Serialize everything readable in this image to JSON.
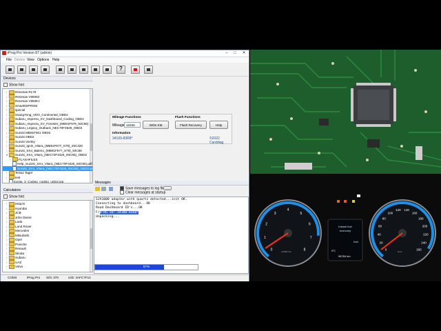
{
  "window": {
    "title": "iProg Pro Version 87 (admin)",
    "min": "–",
    "max": "□",
    "close": "✕"
  },
  "menu": [
    "File",
    "Device",
    "View",
    "Options",
    "Help"
  ],
  "devices_panel": {
    "title": "Devices",
    "show_hint": "Show hint",
    "items": [
      {
        "label": "Renesas RL78",
        "type": "folder",
        "indent": 1
      },
      {
        "label": "Renesas V85062",
        "type": "folder",
        "indent": 1
      },
      {
        "label": "Renesas V850E1",
        "type": "folder",
        "indent": 1
      },
      {
        "label": "SmartEEPROM",
        "type": "folder",
        "indent": 1
      },
      {
        "label": "special",
        "type": "folder",
        "indent": 1
      },
      {
        "label": "SsangYong_VDO_Continental_OBD2",
        "type": "folder",
        "indent": 1
      },
      {
        "label": "Subaru_Impreza_XV_Dashboard_Coding_OBD2",
        "type": "folder",
        "indent": 1
      },
      {
        "label": "Subaru_Impreza_XV_Forester_(MB91F579_93C86)",
        "type": "folder",
        "indent": 1
      },
      {
        "label": "Subaru_Legacy_Outback_NEC70F3529_OBD2",
        "type": "folder",
        "indent": 1
      },
      {
        "label": "Suzuki MB91F061 OBD2",
        "type": "folder",
        "indent": 1
      },
      {
        "label": "Suzuki OBD2",
        "type": "folder",
        "indent": 1
      },
      {
        "label": "Suzuki Vorsky",
        "type": "folder",
        "indent": 1
      },
      {
        "label": "Suzuki_Ignis_Vitara_(MB91F577_S79)_25C320",
        "type": "folder",
        "indent": 1
      },
      {
        "label": "Suzuki_SX4_Baleno_(MB91F577_S79)_93C86",
        "type": "folder",
        "indent": 1
      },
      {
        "label": "Suzuki_SX4_Vitara_(NEC70F3425_93C86)_OBD2",
        "type": "folder",
        "indent": 1,
        "expanded": true
      },
      {
        "label": "FLASHFILES",
        "type": "folder",
        "indent": 2
      },
      {
        "label": "Help_Suzuki_SX4_Vitara_(NEC70F3425_93C86).pdf",
        "type": "file",
        "indent": 2
      },
      {
        "label": "Suzuki_SX4_Vitara_(NEC70F3425_93C86)_OBD2.ipp",
        "type": "file",
        "indent": 2,
        "selected": true
      },
      {
        "label": "TeSaz Tager",
        "type": "folder",
        "indent": 1
      },
      {
        "label": "test",
        "type": "folder",
        "indent": 1
      },
      {
        "label": "toyota_3_Coding_coding_LED2.ipp",
        "type": "file",
        "indent": 1
      }
    ]
  },
  "center": {
    "mileage_title": "Mileage Functions",
    "mileage_label": "Mileage:",
    "mileage_value": "12345",
    "write_km": "Write KM",
    "flash_title": "Flash Functions",
    "flash_recovery": "Flash Recovery",
    "help": "Help",
    "info_title": "Information",
    "info_value": "34100-83R8*",
    "copyright": "©2022 Carddiag"
  },
  "calc_panel": {
    "title": "Calculators",
    "show_hint": "Show hint",
    "items": [
      "Hitachi",
      "Hyundai",
      "JCB",
      "John Deere",
      "Lada",
      "Land Rover",
      "Mercedes",
      "Mitsubishi",
      "Opel",
      "Porsche",
      "Renault",
      "Skoda",
      "Subaru",
      "UAZ",
      "Volvo"
    ]
  },
  "messages": {
    "title": "Messages",
    "save_log": "Save messages to log file",
    "clear_startup": "Clear messages at startup",
    "browse": "...",
    "lines": [
      "SJA1000 adapter with quartz detected...init OK.",
      "Connecting to dashboard...OK",
      "Read Dashboard ID's...OK",
      "Unpacking..."
    ],
    "line_hl_prefix": "F/",
    "line_hl": "W-RG ID: 34100-83R8*",
    "progress_text": "67%",
    "progress": 0.67
  },
  "status": {
    "port": "COM3",
    "product": "iProg Pro",
    "sn": "S/N: 370",
    "uid": "UID: 4AFC7F14"
  },
  "cluster": {
    "left_marks": [
      "0",
      "1",
      "2",
      "3",
      "4",
      "5",
      "6",
      "7",
      "8"
    ],
    "right_marks": [
      "0",
      "20",
      "40",
      "60",
      "80",
      "100",
      "120",
      "140",
      "160",
      "180",
      "200",
      "220",
      "240",
      "260"
    ],
    "display_line1": "Instant fuel",
    "display_line2": "economy",
    "display_unit": "km/L",
    "odo": "96784 km",
    "temp": "0°C",
    "rpm_unit": "x1000r/min",
    "speed_unit": "km/h"
  }
}
